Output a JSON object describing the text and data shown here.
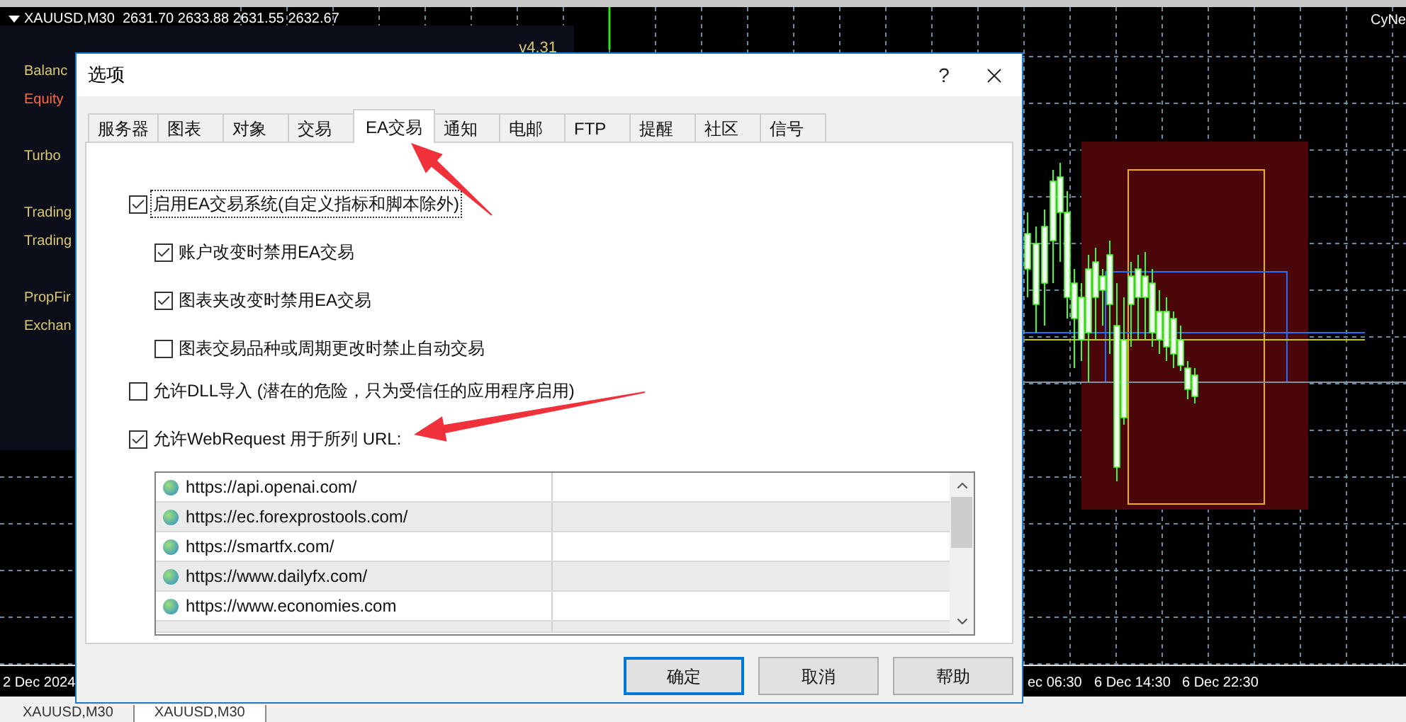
{
  "chart": {
    "header": "XAUUSD,M30  2631.70 2633.88 2631.55 2632.67",
    "corner_label": "CyNe",
    "indicator": {
      "version": "v4.31",
      "labels": [
        {
          "text": "Balanc",
          "color": "#d8c878"
        },
        {
          "text": "Equity",
          "color": "#ff6a4a"
        },
        {
          "text": "Turbo",
          "color": "#d8c878"
        },
        {
          "text": "Trading",
          "color": "#d8c878"
        },
        {
          "text": "Trading",
          "color": "#d8c878"
        },
        {
          "text": "PropFir",
          "color": "#d8c878"
        },
        {
          "text": "Exchan",
          "color": "#d8c878"
        }
      ]
    },
    "time_axis": [
      "2 Dec 2024",
      "ec 06:30",
      "6 Dec 14:30",
      "6 Dec 22:30"
    ]
  },
  "chart_tabs": [
    {
      "label": "XAUUSD,M30",
      "selected": false
    },
    {
      "label": "XAUUSD,M30",
      "selected": true
    }
  ],
  "dialog": {
    "title": "选项",
    "help": "?",
    "tabs": [
      {
        "label": "服务器",
        "selected": false
      },
      {
        "label": "图表",
        "selected": false
      },
      {
        "label": "对象",
        "selected": false
      },
      {
        "label": "交易",
        "selected": false
      },
      {
        "label": "EA交易",
        "selected": true
      },
      {
        "label": "通知",
        "selected": false
      },
      {
        "label": "电邮",
        "selected": false
      },
      {
        "label": "FTP",
        "selected": false
      },
      {
        "label": "提醒",
        "selected": false
      },
      {
        "label": "社区",
        "selected": false
      },
      {
        "label": "信号",
        "selected": false
      }
    ],
    "options": [
      {
        "label": "启用EA交易系统(自定义指标和脚本除外)",
        "checked": true,
        "focused": true,
        "children": [
          {
            "label": "账户改变时禁用EA交易",
            "checked": true,
            "focused": false
          },
          {
            "label": "图表夹改变时禁用EA交易",
            "checked": true,
            "focused": false
          },
          {
            "label": "图表交易品种或周期更改时禁止自动交易",
            "checked": false,
            "focused": false
          }
        ]
      },
      {
        "label": "允许DLL导入 (潜在的危险，只为受信任的应用程序启用)",
        "checked": false,
        "focused": false
      },
      {
        "label": "允许WebRequest 用于所列 URL:",
        "checked": true,
        "focused": false
      }
    ],
    "urls": [
      "https://api.openai.com/",
      "https://ec.forexprostools.com/",
      "https://smartfx.com/",
      "https://www.dailyfx.com/",
      "https://www.economies.com"
    ],
    "buttons": [
      {
        "label": "确定",
        "default": true
      },
      {
        "label": "取消",
        "default": false
      },
      {
        "label": "帮助",
        "default": false
      }
    ]
  }
}
